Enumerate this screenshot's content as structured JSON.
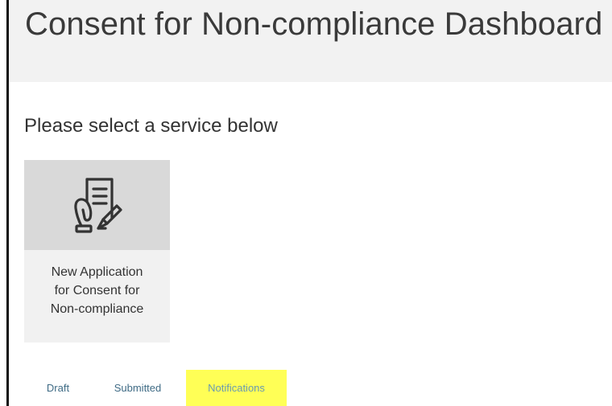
{
  "page": {
    "title": "Consent for Non-compliance Dashboard",
    "section_heading": "Please select a service below"
  },
  "service_card": {
    "icon": "hand-holding-document-with-pen-icon",
    "label_lines": [
      "New Application",
      "for Consent for",
      "Non-compliance"
    ]
  },
  "tabs": [
    {
      "label": "Draft"
    },
    {
      "label": "Submitted"
    },
    {
      "label": "Notifications",
      "highlighted": true
    }
  ],
  "colors": {
    "header_bg": "#f2f2f2",
    "card_bg": "#f1f1f1",
    "card_icon_bg": "#d9d9d9",
    "tab_text": "#3f6b85",
    "highlight": "#ffff56"
  }
}
